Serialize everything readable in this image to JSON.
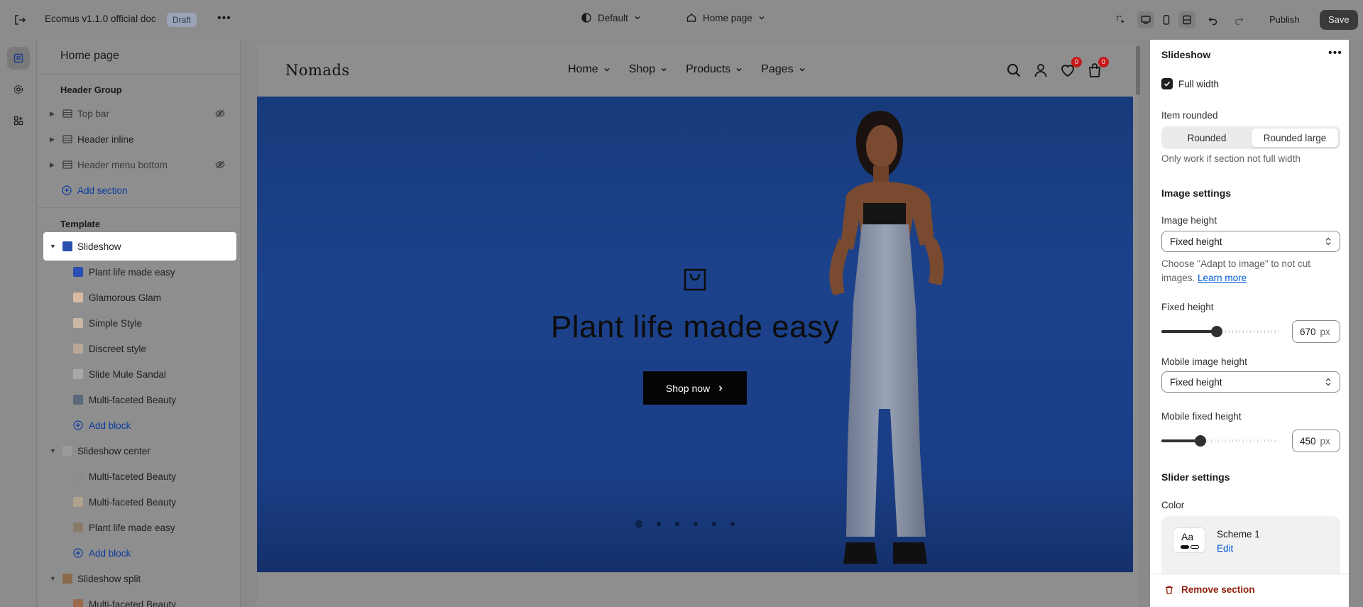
{
  "topbar": {
    "store_title": "Ecomus v1.1.0 official doc",
    "status_badge": "Draft",
    "more": "•••",
    "theme_label": "Default",
    "page_label": "Home page",
    "publish_label": "Publish",
    "save_label": "Save"
  },
  "left_panel": {
    "title": "Home page",
    "header_group": {
      "heading": "Header Group",
      "items": [
        {
          "label": "Top bar",
          "hidden": true
        },
        {
          "label": "Header inline",
          "hidden": false
        },
        {
          "label": "Header menu bottom",
          "hidden": true
        }
      ],
      "add_label": "Add section"
    },
    "template": {
      "heading": "Template",
      "slideshow": {
        "label": "Slideshow",
        "blocks": [
          "Plant life made easy",
          "Glamorous Glam",
          "Simple Style",
          "Discreet style",
          "Slide Mule Sandal",
          "Multi-faceted Beauty"
        ],
        "add_block": "Add block"
      },
      "slideshow_center": {
        "label": "Slideshow center",
        "blocks": [
          "Multi-faceted Beauty",
          "Multi-faceted Beauty",
          "Plant life made easy"
        ],
        "add_block": "Add block"
      },
      "slideshow_split": {
        "label": "Slideshow split",
        "blocks": [
          "Multi-faceted Beauty"
        ]
      }
    }
  },
  "preview": {
    "logo": "Nomads",
    "nav": [
      "Home",
      "Shop",
      "Products",
      "Pages"
    ],
    "wishlist_count": "0",
    "cart_count": "0",
    "hero_title": "Plant life made easy",
    "hero_button": "Shop now",
    "slides_count": 6,
    "active_slide": 1
  },
  "right_panel": {
    "title": "Slideshow",
    "full_width_label": "Full width",
    "full_width_checked": true,
    "item_rounded_label": "Item rounded",
    "item_rounded_options": [
      "Rounded",
      "Rounded large"
    ],
    "item_rounded_selected": "Rounded large",
    "item_rounded_help": "Only work if section not full width",
    "image_settings_heading": "Image settings",
    "image_height_label": "Image height",
    "image_height_value": "Fixed height",
    "image_height_help": "Choose \"Adapt to image\" to not cut images.",
    "learn_more": "Learn more",
    "fixed_height_label": "Fixed height",
    "fixed_height_value": "670",
    "fixed_height_unit": "px",
    "fixed_height_fraction": 0.47,
    "mobile_image_height_label": "Mobile image height",
    "mobile_image_height_value": "Fixed height",
    "mobile_fixed_height_label": "Mobile fixed height",
    "mobile_fixed_height_value": "450",
    "mobile_fixed_height_unit": "px",
    "mobile_fixed_height_fraction": 0.33,
    "slider_settings_heading": "Slider settings",
    "color_label": "Color",
    "scheme_sample": "Aa",
    "scheme_name": "Scheme 1",
    "scheme_edit": "Edit",
    "remove_label": "Remove section"
  }
}
